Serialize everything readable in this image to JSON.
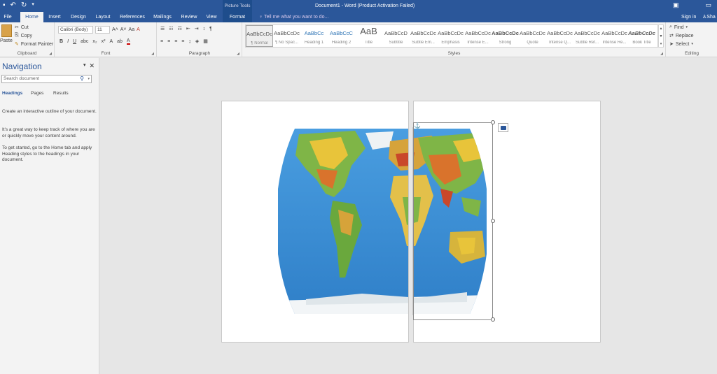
{
  "titlebar": {
    "document_title": "Document1 - Word (Product Activation Failed)",
    "context_header": "Picture Tools"
  },
  "tabs": [
    "File",
    "Home",
    "Insert",
    "Design",
    "Layout",
    "References",
    "Mailings",
    "Review",
    "View",
    "Format"
  ],
  "tell_me": "Tell me what you want to do...",
  "signin": "Sign in",
  "share": "Sha",
  "clipboard": {
    "paste": "Paste",
    "cut": "Cut",
    "copy": "Copy",
    "format_painter": "Format Painter",
    "label": "Clipboard"
  },
  "font": {
    "name": "Calibri (Body)",
    "size": "11",
    "label": "Font"
  },
  "paragraph": {
    "label": "Paragraph"
  },
  "styles": {
    "label": "Styles",
    "items": [
      {
        "preview": "AaBbCcDc",
        "name": "¶ Normal"
      },
      {
        "preview": "AaBbCcDc",
        "name": "¶ No Spac..."
      },
      {
        "preview": "AaBbCc",
        "name": "Heading 1"
      },
      {
        "preview": "AaBbCcC",
        "name": "Heading 2"
      },
      {
        "preview": "AaB",
        "name": "Title"
      },
      {
        "preview": "AaBbCcD",
        "name": "Subtitle"
      },
      {
        "preview": "AaBbCcDc",
        "name": "Subtle Em..."
      },
      {
        "preview": "AaBbCcDc",
        "name": "Emphasis"
      },
      {
        "preview": "AaBbCcDc",
        "name": "Intense E..."
      },
      {
        "preview": "AaBbCcDc",
        "name": "Strong"
      },
      {
        "preview": "AaBbCcDc",
        "name": "Quote"
      },
      {
        "preview": "AaBbCcDc",
        "name": "Intense Q..."
      },
      {
        "preview": "AaBbCcDc",
        "name": "Subtle Ref..."
      },
      {
        "preview": "AaBbCcDc",
        "name": "Intense Re..."
      },
      {
        "preview": "AaBbCcDc",
        "name": "Book Title"
      }
    ]
  },
  "editing": {
    "find": "Find",
    "replace": "Replace",
    "select": "Select",
    "label": "Editing"
  },
  "navigation": {
    "title": "Navigation",
    "search_placeholder": "Search document",
    "tabs": [
      "Headings",
      "Pages",
      "Results"
    ],
    "text1": "Create an interactive outline of your document.",
    "text2": "It's a great way to keep track of where you are or quickly move your content around.",
    "text3": "To get started, go to the Home tab and apply Heading styles to the headings in your document."
  },
  "colors": {
    "accent": "#2b579a",
    "ribbon": "#f3f3f3",
    "canvas": "#e6e6e6"
  }
}
